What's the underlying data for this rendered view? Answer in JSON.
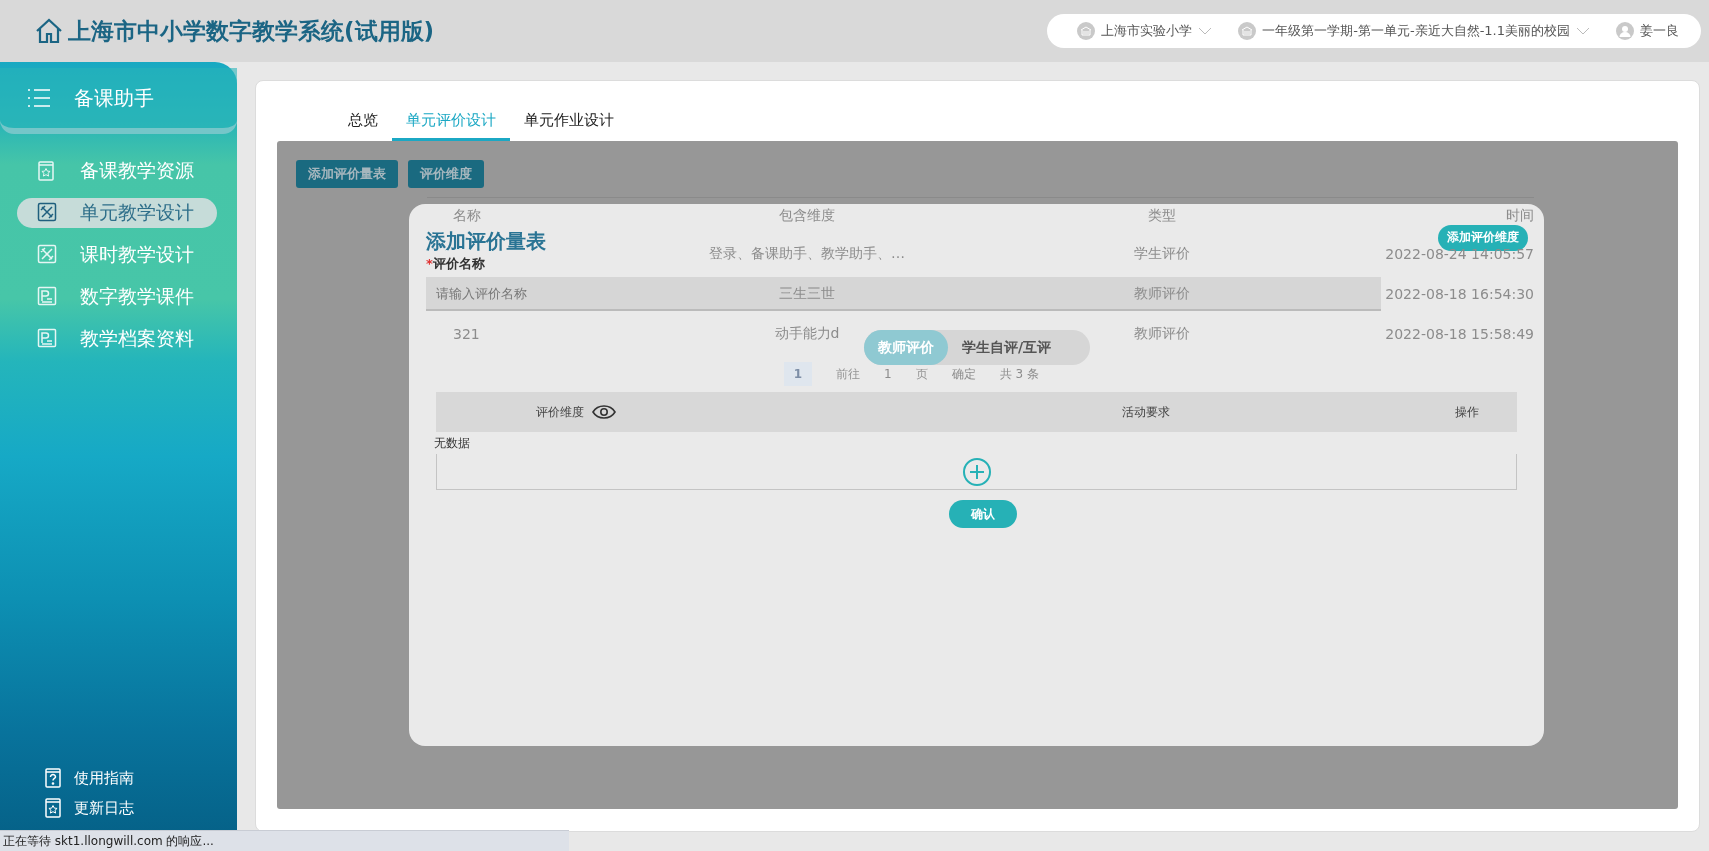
{
  "header": {
    "title": "上海市中小学数字教学系统(试用版)",
    "selectors": [
      {
        "kind": "school",
        "label": "上海市实验小学"
      },
      {
        "kind": "school",
        "label": "一年级第一学期-第一单元-亲近大自然-1.1美丽的校园"
      },
      {
        "kind": "user",
        "label": "姜一良"
      }
    ]
  },
  "sidebar": {
    "title": "备课助手",
    "items": [
      {
        "label": "备课教学资源",
        "kind": "book",
        "selected": false
      },
      {
        "label": "单元教学设计",
        "kind": "tools",
        "selected": true
      },
      {
        "label": "课时教学设计",
        "kind": "tools",
        "selected": false
      },
      {
        "label": "数字教学课件",
        "kind": "slides",
        "selected": false
      },
      {
        "label": "教学档案资料",
        "kind": "slides",
        "selected": false
      }
    ],
    "footer_items": [
      {
        "label": "使用指南",
        "kind": "help"
      },
      {
        "label": "更新日志",
        "kind": "book"
      }
    ]
  },
  "tabs": [
    {
      "label": "总览",
      "selected": false
    },
    {
      "label": "单元评价设计",
      "selected": true
    },
    {
      "label": "单元作业设计",
      "selected": false
    }
  ],
  "toolbar": [
    "添加评价量表",
    "评价维度"
  ],
  "table": {
    "columns": [
      "名称",
      "包含维度",
      "类型",
      "时间"
    ],
    "rows": [
      {
        "dimensions": "登录、备课助手、教学助手、…",
        "type": "学生评价",
        "time": "2022-08-24 14:05:57"
      },
      {
        "dimensions": "三生三世",
        "type": "教师评价",
        "time": "2022-08-18 16:54:30"
      },
      {
        "name": "321",
        "dimensions": "动手能力d",
        "type": "教师评价",
        "time": "2022-08-18 15:58:49"
      }
    ]
  },
  "pagination": {
    "current": "1",
    "goto": "前往",
    "page": "1",
    "unit": "页",
    "confirm": "确定",
    "total": "共 3 条"
  },
  "modal": {
    "title": "添加评价量表",
    "add_dimension_button": "添加评价维度",
    "required_mark": "*",
    "name_label": "评价名称",
    "name_field": {
      "placeholder": "请输入评价名称"
    },
    "segments": [
      {
        "label": "教师评价",
        "selected": true
      },
      {
        "label": "学生自评/互评",
        "selected": false
      }
    ],
    "columns": [
      "评价维度",
      "活动要求",
      "操作"
    ],
    "empty_text": "无数据",
    "confirm_button": "确认"
  },
  "status_bar": "正在等待 skt1.llongwill.com 的响应..."
}
